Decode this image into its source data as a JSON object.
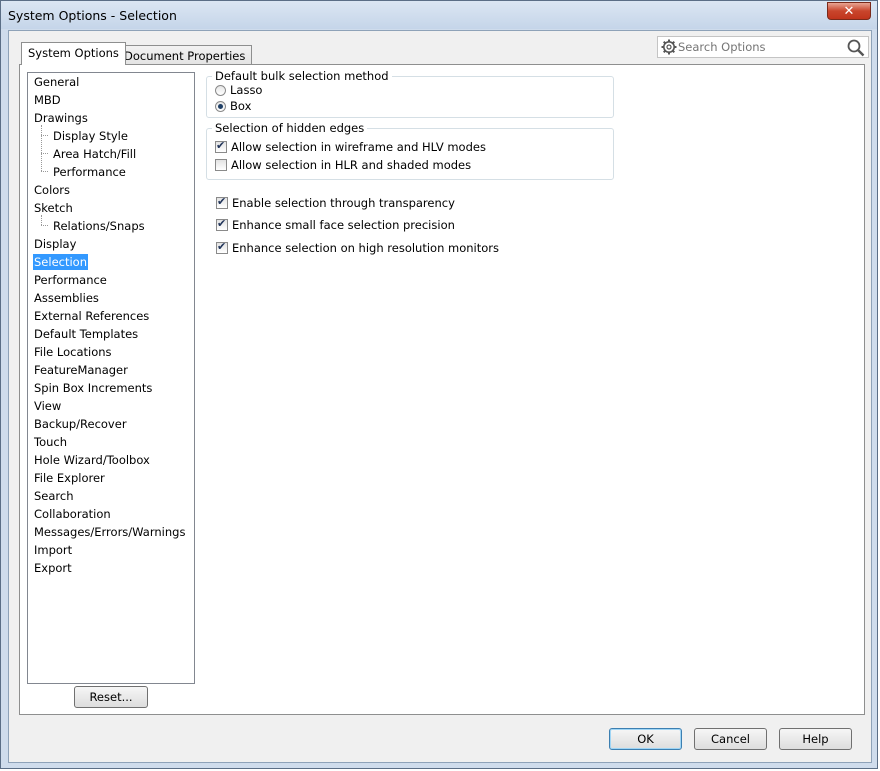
{
  "window": {
    "title": "System Options - Selection",
    "close_label": "✕"
  },
  "tabs": [
    {
      "label": "System Options",
      "active": true
    },
    {
      "label": "Document Properties",
      "active": false
    }
  ],
  "search": {
    "placeholder": "Search Options",
    "value": ""
  },
  "tree": {
    "items": [
      {
        "label": "General",
        "level": 0
      },
      {
        "label": "MBD",
        "level": 0
      },
      {
        "label": "Drawings",
        "level": 0
      },
      {
        "label": "Display Style",
        "level": 1
      },
      {
        "label": "Area Hatch/Fill",
        "level": 1
      },
      {
        "label": "Performance",
        "level": 1
      },
      {
        "label": "Colors",
        "level": 0
      },
      {
        "label": "Sketch",
        "level": 0
      },
      {
        "label": "Relations/Snaps",
        "level": 1
      },
      {
        "label": "Display",
        "level": 0
      },
      {
        "label": "Selection",
        "level": 0,
        "selected": true
      },
      {
        "label": "Performance",
        "level": 0
      },
      {
        "label": "Assemblies",
        "level": 0
      },
      {
        "label": "External References",
        "level": 0
      },
      {
        "label": "Default Templates",
        "level": 0
      },
      {
        "label": "File Locations",
        "level": 0
      },
      {
        "label": "FeatureManager",
        "level": 0
      },
      {
        "label": "Spin Box Increments",
        "level": 0
      },
      {
        "label": "View",
        "level": 0
      },
      {
        "label": "Backup/Recover",
        "level": 0
      },
      {
        "label": "Touch",
        "level": 0
      },
      {
        "label": "Hole Wizard/Toolbox",
        "level": 0
      },
      {
        "label": "File Explorer",
        "level": 0
      },
      {
        "label": "Search",
        "level": 0
      },
      {
        "label": "Collaboration",
        "level": 0
      },
      {
        "label": "Messages/Errors/Warnings",
        "level": 0
      },
      {
        "label": "Import",
        "level": 0
      },
      {
        "label": "Export",
        "level": 0
      }
    ],
    "reset_label": "Reset..."
  },
  "bulk_selection": {
    "legend": "Default bulk selection method",
    "options": [
      {
        "label": "Lasso",
        "selected": false
      },
      {
        "label": "Box",
        "selected": true
      }
    ]
  },
  "hidden_edges": {
    "legend": "Selection of hidden edges",
    "options": [
      {
        "label": "Allow selection in wireframe and HLV modes",
        "checked": true
      },
      {
        "label": "Allow selection in HLR and shaded modes",
        "checked": false
      }
    ]
  },
  "standalone_options": [
    {
      "label": "Enable selection through transparency",
      "checked": true
    },
    {
      "label": "Enhance small face selection precision",
      "checked": true
    },
    {
      "label": "Enhance selection on high resolution monitors",
      "checked": true
    }
  ],
  "buttons": {
    "ok": "OK",
    "cancel": "Cancel",
    "help": "Help"
  }
}
